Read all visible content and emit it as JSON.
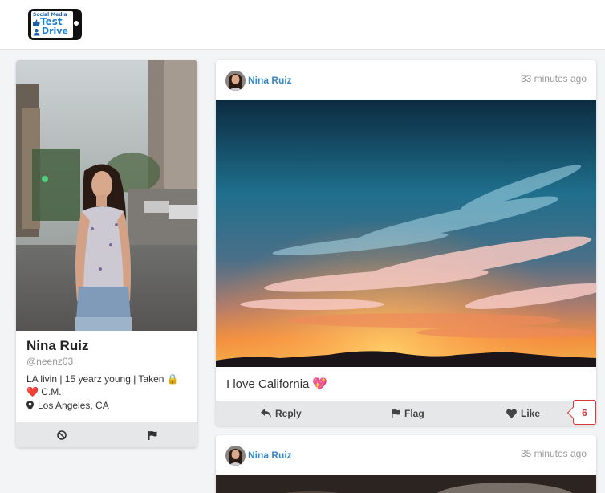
{
  "header": {
    "logo": {
      "line1": "Social Media",
      "line2": "Test",
      "line3": "Drive"
    }
  },
  "profile": {
    "name": "Nina Ruiz",
    "handle": "@neenz03",
    "bio_line1": "LA livin | 15 yearz young | Taken 🔒",
    "bio_line2": "❤️ C.M.",
    "location": "Los Angeles, CA",
    "actions": [
      {
        "icon": "block-icon"
      },
      {
        "icon": "flag-icon"
      }
    ]
  },
  "posts": [
    {
      "author": "Nina Ruiz",
      "time": "33 minutes ago",
      "text": "I love California",
      "emoji": "💖",
      "actions": {
        "reply": "Reply",
        "flag": "Flag",
        "like": "Like"
      },
      "likes": "6"
    },
    {
      "author": "Nina Ruiz",
      "time": "35 minutes ago"
    }
  ],
  "colors": {
    "link": "#3a88c6",
    "like_badge": "#d43a3a",
    "action_bar": "#e6e7e8"
  }
}
